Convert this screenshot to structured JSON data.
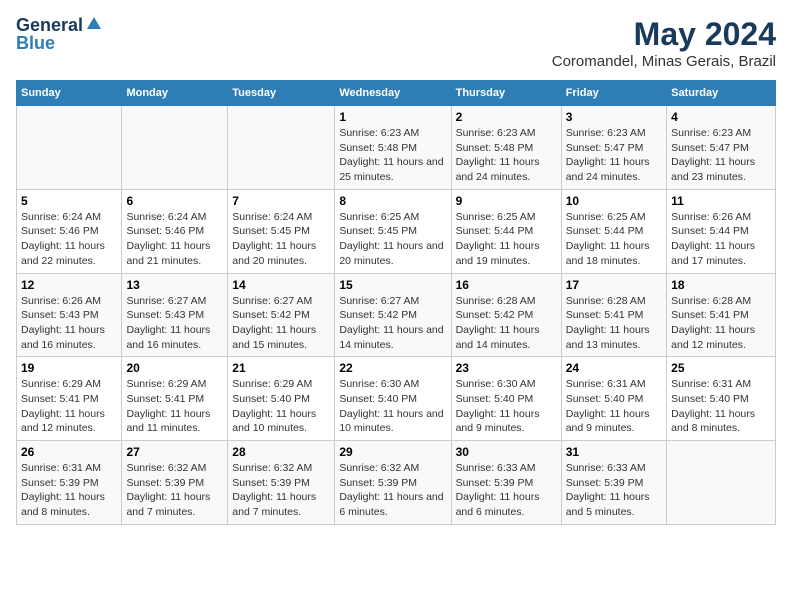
{
  "header": {
    "logo_general": "General",
    "logo_blue": "Blue",
    "title": "May 2024",
    "subtitle": "Coromandel, Minas Gerais, Brazil"
  },
  "weekdays": [
    "Sunday",
    "Monday",
    "Tuesday",
    "Wednesday",
    "Thursday",
    "Friday",
    "Saturday"
  ],
  "weeks": [
    [
      {
        "day": "",
        "sunrise": "",
        "sunset": "",
        "daylight": ""
      },
      {
        "day": "",
        "sunrise": "",
        "sunset": "",
        "daylight": ""
      },
      {
        "day": "",
        "sunrise": "",
        "sunset": "",
        "daylight": ""
      },
      {
        "day": "1",
        "sunrise": "Sunrise: 6:23 AM",
        "sunset": "Sunset: 5:48 PM",
        "daylight": "Daylight: 11 hours and 25 minutes."
      },
      {
        "day": "2",
        "sunrise": "Sunrise: 6:23 AM",
        "sunset": "Sunset: 5:48 PM",
        "daylight": "Daylight: 11 hours and 24 minutes."
      },
      {
        "day": "3",
        "sunrise": "Sunrise: 6:23 AM",
        "sunset": "Sunset: 5:47 PM",
        "daylight": "Daylight: 11 hours and 24 minutes."
      },
      {
        "day": "4",
        "sunrise": "Sunrise: 6:23 AM",
        "sunset": "Sunset: 5:47 PM",
        "daylight": "Daylight: 11 hours and 23 minutes."
      }
    ],
    [
      {
        "day": "5",
        "sunrise": "Sunrise: 6:24 AM",
        "sunset": "Sunset: 5:46 PM",
        "daylight": "Daylight: 11 hours and 22 minutes."
      },
      {
        "day": "6",
        "sunrise": "Sunrise: 6:24 AM",
        "sunset": "Sunset: 5:46 PM",
        "daylight": "Daylight: 11 hours and 21 minutes."
      },
      {
        "day": "7",
        "sunrise": "Sunrise: 6:24 AM",
        "sunset": "Sunset: 5:45 PM",
        "daylight": "Daylight: 11 hours and 20 minutes."
      },
      {
        "day": "8",
        "sunrise": "Sunrise: 6:25 AM",
        "sunset": "Sunset: 5:45 PM",
        "daylight": "Daylight: 11 hours and 20 minutes."
      },
      {
        "day": "9",
        "sunrise": "Sunrise: 6:25 AM",
        "sunset": "Sunset: 5:44 PM",
        "daylight": "Daylight: 11 hours and 19 minutes."
      },
      {
        "day": "10",
        "sunrise": "Sunrise: 6:25 AM",
        "sunset": "Sunset: 5:44 PM",
        "daylight": "Daylight: 11 hours and 18 minutes."
      },
      {
        "day": "11",
        "sunrise": "Sunrise: 6:26 AM",
        "sunset": "Sunset: 5:44 PM",
        "daylight": "Daylight: 11 hours and 17 minutes."
      }
    ],
    [
      {
        "day": "12",
        "sunrise": "Sunrise: 6:26 AM",
        "sunset": "Sunset: 5:43 PM",
        "daylight": "Daylight: 11 hours and 16 minutes."
      },
      {
        "day": "13",
        "sunrise": "Sunrise: 6:27 AM",
        "sunset": "Sunset: 5:43 PM",
        "daylight": "Daylight: 11 hours and 16 minutes."
      },
      {
        "day": "14",
        "sunrise": "Sunrise: 6:27 AM",
        "sunset": "Sunset: 5:42 PM",
        "daylight": "Daylight: 11 hours and 15 minutes."
      },
      {
        "day": "15",
        "sunrise": "Sunrise: 6:27 AM",
        "sunset": "Sunset: 5:42 PM",
        "daylight": "Daylight: 11 hours and 14 minutes."
      },
      {
        "day": "16",
        "sunrise": "Sunrise: 6:28 AM",
        "sunset": "Sunset: 5:42 PM",
        "daylight": "Daylight: 11 hours and 14 minutes."
      },
      {
        "day": "17",
        "sunrise": "Sunrise: 6:28 AM",
        "sunset": "Sunset: 5:41 PM",
        "daylight": "Daylight: 11 hours and 13 minutes."
      },
      {
        "day": "18",
        "sunrise": "Sunrise: 6:28 AM",
        "sunset": "Sunset: 5:41 PM",
        "daylight": "Daylight: 11 hours and 12 minutes."
      }
    ],
    [
      {
        "day": "19",
        "sunrise": "Sunrise: 6:29 AM",
        "sunset": "Sunset: 5:41 PM",
        "daylight": "Daylight: 11 hours and 12 minutes."
      },
      {
        "day": "20",
        "sunrise": "Sunrise: 6:29 AM",
        "sunset": "Sunset: 5:41 PM",
        "daylight": "Daylight: 11 hours and 11 minutes."
      },
      {
        "day": "21",
        "sunrise": "Sunrise: 6:29 AM",
        "sunset": "Sunset: 5:40 PM",
        "daylight": "Daylight: 11 hours and 10 minutes."
      },
      {
        "day": "22",
        "sunrise": "Sunrise: 6:30 AM",
        "sunset": "Sunset: 5:40 PM",
        "daylight": "Daylight: 11 hours and 10 minutes."
      },
      {
        "day": "23",
        "sunrise": "Sunrise: 6:30 AM",
        "sunset": "Sunset: 5:40 PM",
        "daylight": "Daylight: 11 hours and 9 minutes."
      },
      {
        "day": "24",
        "sunrise": "Sunrise: 6:31 AM",
        "sunset": "Sunset: 5:40 PM",
        "daylight": "Daylight: 11 hours and 9 minutes."
      },
      {
        "day": "25",
        "sunrise": "Sunrise: 6:31 AM",
        "sunset": "Sunset: 5:40 PM",
        "daylight": "Daylight: 11 hours and 8 minutes."
      }
    ],
    [
      {
        "day": "26",
        "sunrise": "Sunrise: 6:31 AM",
        "sunset": "Sunset: 5:39 PM",
        "daylight": "Daylight: 11 hours and 8 minutes."
      },
      {
        "day": "27",
        "sunrise": "Sunrise: 6:32 AM",
        "sunset": "Sunset: 5:39 PM",
        "daylight": "Daylight: 11 hours and 7 minutes."
      },
      {
        "day": "28",
        "sunrise": "Sunrise: 6:32 AM",
        "sunset": "Sunset: 5:39 PM",
        "daylight": "Daylight: 11 hours and 7 minutes."
      },
      {
        "day": "29",
        "sunrise": "Sunrise: 6:32 AM",
        "sunset": "Sunset: 5:39 PM",
        "daylight": "Daylight: 11 hours and 6 minutes."
      },
      {
        "day": "30",
        "sunrise": "Sunrise: 6:33 AM",
        "sunset": "Sunset: 5:39 PM",
        "daylight": "Daylight: 11 hours and 6 minutes."
      },
      {
        "day": "31",
        "sunrise": "Sunrise: 6:33 AM",
        "sunset": "Sunset: 5:39 PM",
        "daylight": "Daylight: 11 hours and 5 minutes."
      },
      {
        "day": "",
        "sunrise": "",
        "sunset": "",
        "daylight": ""
      }
    ]
  ]
}
